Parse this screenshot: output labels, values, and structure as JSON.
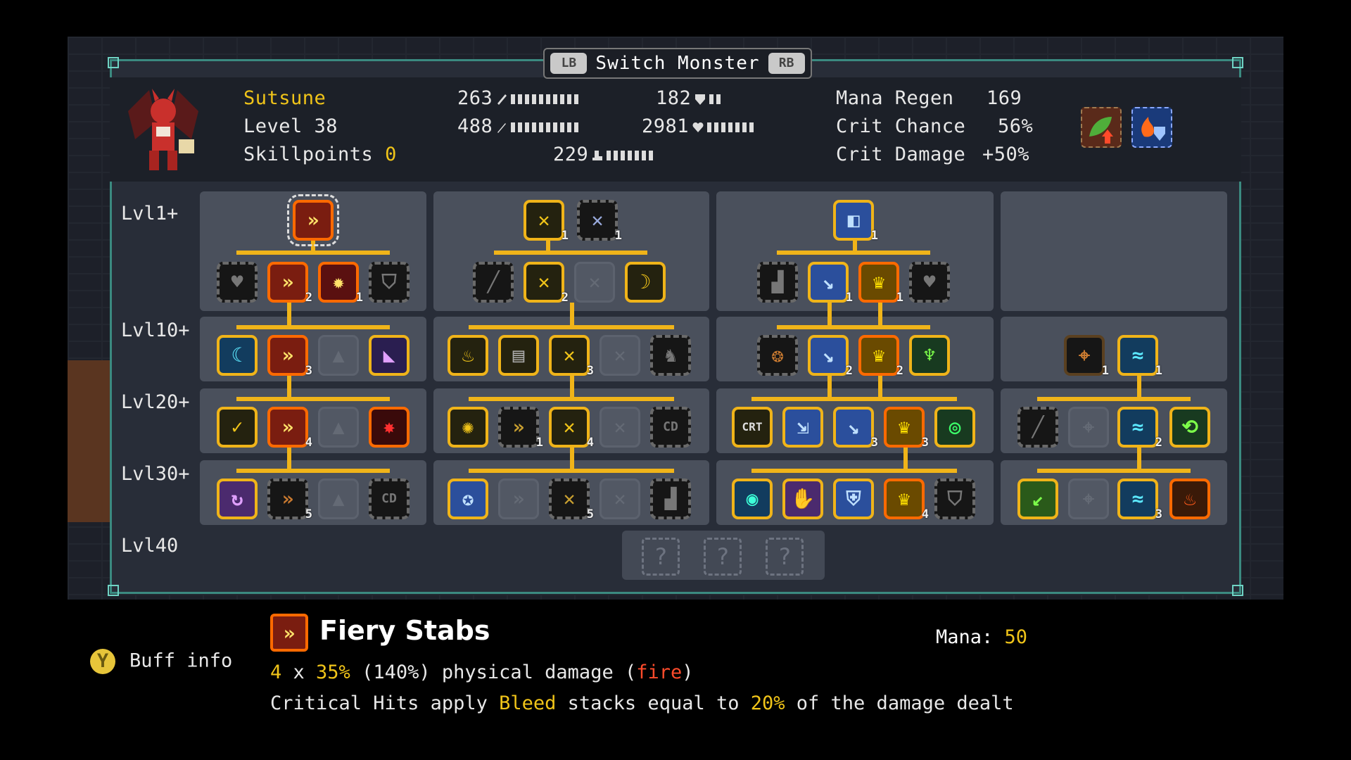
{
  "switch_bar": {
    "left_button": "LB",
    "title": "Switch Monster",
    "right_button": "RB"
  },
  "monster": {
    "name": "Sutsune",
    "level_label": "Level 38",
    "skillpoints_label": "Skillpoints",
    "skillpoints_value": "0"
  },
  "stats": {
    "attack": "263",
    "magic": "488",
    "speed": "229",
    "defense": "182",
    "health": "2981",
    "mana_regen_label": "Mana Regen",
    "mana_regen_value": "169",
    "crit_chance_label": "Crit Chance",
    "crit_chance_value": "56%",
    "crit_damage_label": "Crit Damage",
    "crit_damage_value": "+50%"
  },
  "status_icons": [
    "leaf-attack-up-icon",
    "fire-shield-icon"
  ],
  "row_labels": [
    "Lvl1+",
    "Lvl10+",
    "Lvl20+",
    "Lvl30+",
    "Lvl40"
  ],
  "ranks": {
    "t1_root": "",
    "t1_r1b": "2",
    "t1_r1c": "1",
    "t1_r2b": "3",
    "t1_r3b": "4",
    "t1_r4b": "5",
    "t2_root_a": "1",
    "t2_root_b": "1",
    "t2_r1b": "2",
    "t2_r2c": "3",
    "t2_r3b": "1",
    "t2_r3c": "4",
    "t2_r4c": "5",
    "t3_root": "1",
    "t3_r1b": "1",
    "t3_r1c": "1",
    "t3_r2b": "2",
    "t3_r2c": "2",
    "t3_r3c": "3",
    "t3_r3d": "3",
    "t3_r4d": "4",
    "t4_r2a": "1",
    "t4_r2b": "1",
    "t4_r3b": "2",
    "t4_r4b": "3"
  },
  "lvl40_slots": [
    "?",
    "?",
    "?"
  ],
  "footer": {
    "buff_button": "Y",
    "buff_label": "Buff info",
    "skill_name": "Fiery Stabs",
    "mana_label": "Mana:",
    "mana_value": "50",
    "line1": {
      "hits": "4",
      "times": " x ",
      "pct": "35%",
      "total": " (140%) physical damage (",
      "element": "fire",
      "close": ")"
    },
    "line2": {
      "pre": "Critical Hits apply ",
      "effect": "Bleed",
      "mid": " stacks equal to ",
      "pct": "20%",
      "post": " of the damage dealt"
    }
  },
  "colors": {
    "gold": "#f0c419",
    "accent_fire": "#ff6a00",
    "panel_border": "#3b8a80"
  }
}
